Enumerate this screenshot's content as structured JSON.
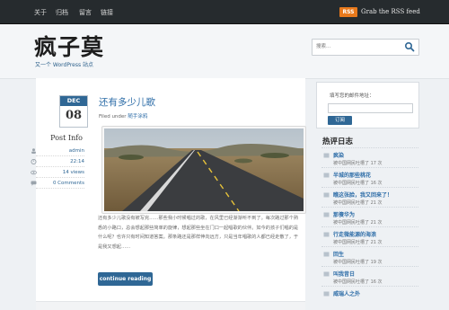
{
  "nav": {
    "items": [
      "关于",
      "归档",
      "留言",
      "链接"
    ]
  },
  "rss": {
    "badge": "RSS",
    "label": "Grab the RSS feed"
  },
  "header": {
    "title": "疯子莫",
    "tagline": "又一个 WordPress 站点"
  },
  "search": {
    "placeholder": "搜索..."
  },
  "post": {
    "date_month": "DEC",
    "date_day": "08",
    "title": "还有多少儿歌",
    "filed_under_label": "Filed under",
    "category": "随手涂鸦",
    "info_title": "Post Info",
    "author": "admin",
    "time": "22:14",
    "views": "14 views",
    "comments": "0 Comments",
    "excerpt": "还有多少儿歌没有被写完……那些我小时候唱过的歌，在风里已经渐渐听不到了。每次路过那个熟悉的小路口，总会想起那些简单的旋律，想起那些坐在门口一起唱歌的伙伴。如今的孩子们唱的是什么呢？也许只有时间知道答案。那条路还是那样伸向远方，只是当年唱歌的人都已经走散了，于是我又想起……",
    "read_more": "continue reading »"
  },
  "sidebar": {
    "subscribe_label": "填写您的邮件地址：",
    "subscribe_button": "订阅",
    "hot_title": "热评日志",
    "hot_items": [
      {
        "title": "疯染",
        "meta": "被中国网民吐槽了 17 次"
      },
      {
        "title": "半城的那些桃花",
        "meta": "被中国网民吐槽了 16 次"
      },
      {
        "title": "瞧这张脸，我又回来了！",
        "meta": "被中国网民吐槽了 21 次"
      },
      {
        "title": "那傻华为",
        "meta": "被中国网民吐槽了 21 次"
      },
      {
        "title": "行走微能源的海浪",
        "meta": "被中国网民吐槽了 21 次"
      },
      {
        "title": "回生",
        "meta": "被中国网民吐槽了 19 次"
      },
      {
        "title": "叫我昔日",
        "meta": "被中国网民吐槽了 16 次"
      },
      {
        "title": "威瑞人之外",
        "meta": ""
      }
    ]
  }
}
